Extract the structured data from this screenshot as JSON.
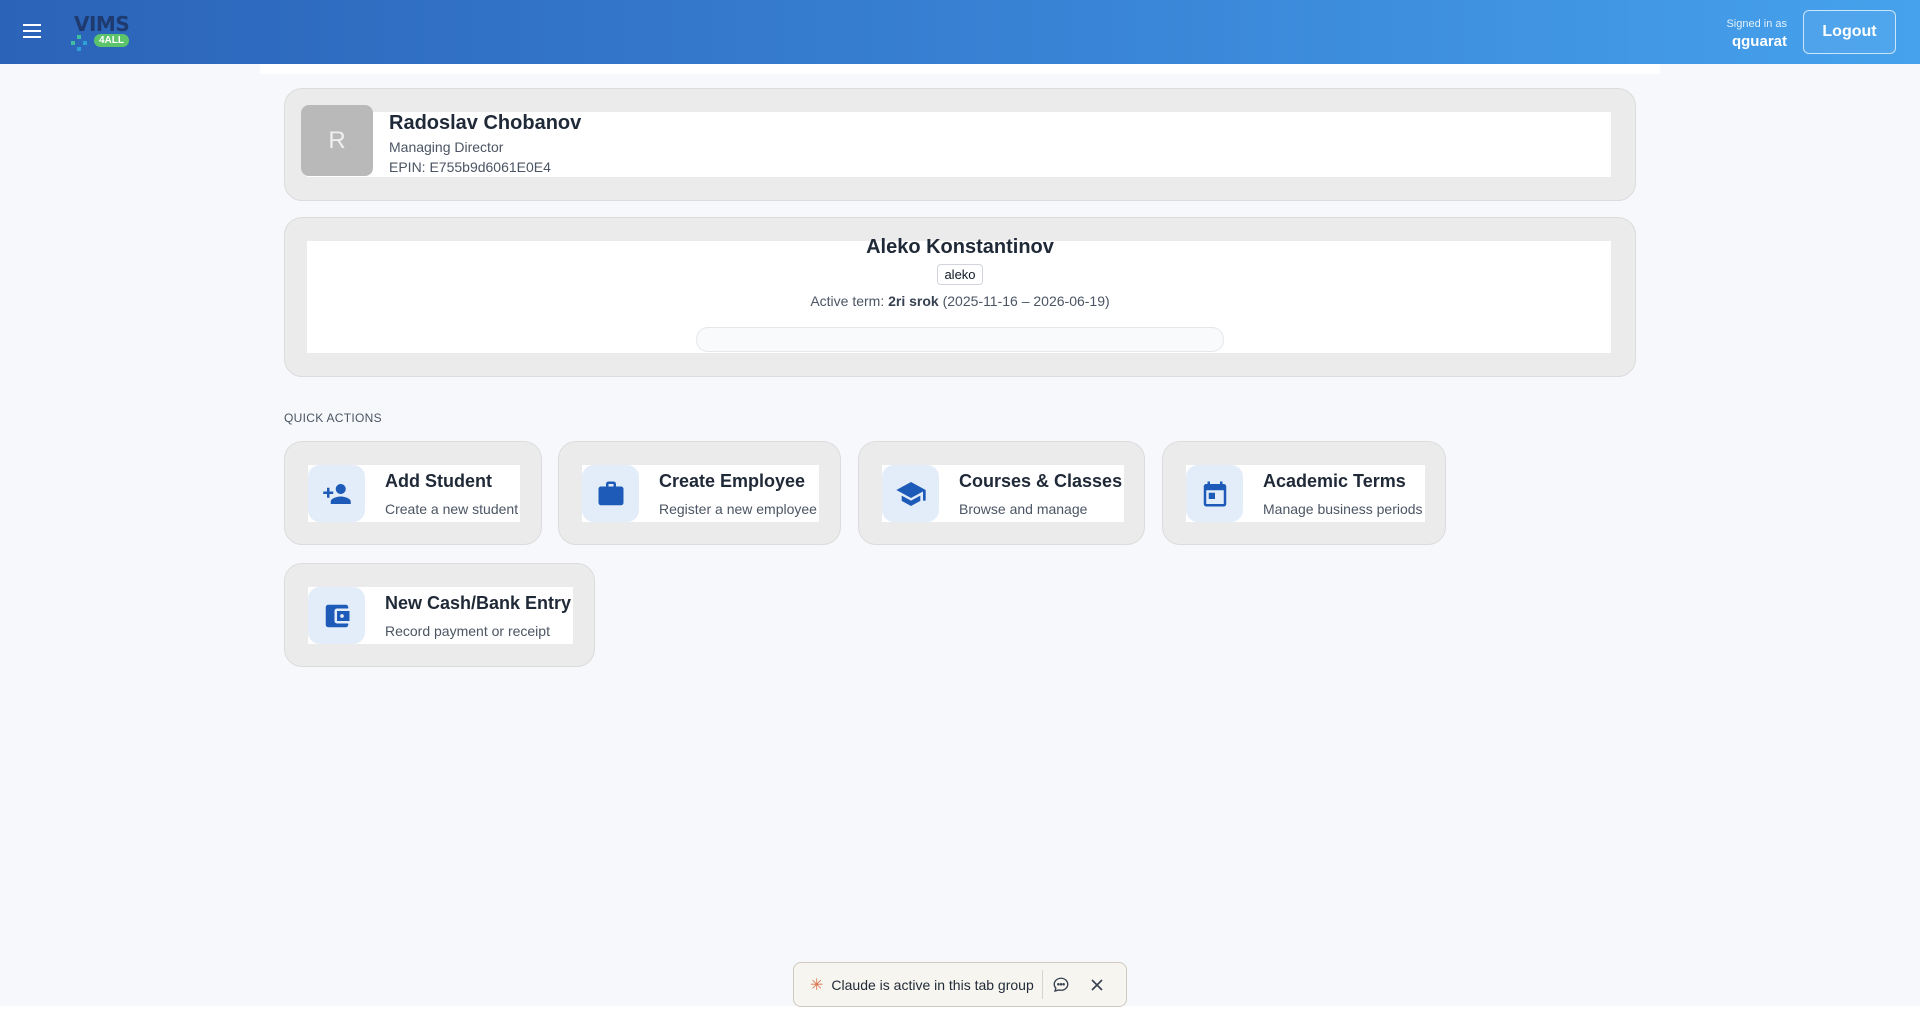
{
  "header": {
    "logo_text": "VIMS",
    "logo_badge": "4ALL",
    "signed_in_label": "Signed in as",
    "username": "qguarat",
    "logout_label": "Logout"
  },
  "profile": {
    "initial": "R",
    "name": "Radoslav Chobanov",
    "role": "Managing Director",
    "epin": "EPIN: E755b9d6061E0E4"
  },
  "student": {
    "name": "Aleko Konstantinov",
    "tag": "aleko",
    "term_prefix": "Active term:",
    "term_name": "2ri srok",
    "term_dates": "(2025-11-16 – 2026-06-19)",
    "term_progress": 0
  },
  "quick_actions": {
    "title": "QUICK ACTIONS",
    "items": [
      {
        "title": "Add Student",
        "subtitle": "Create a new student",
        "icon": "person-add-icon"
      },
      {
        "title": "Create Employee",
        "subtitle": "Register a new employee",
        "icon": "briefcase-icon"
      },
      {
        "title": "Courses & Classes",
        "subtitle": "Browse and manage",
        "icon": "graduation-cap-icon"
      },
      {
        "title": "Academic Terms",
        "subtitle": "Manage business periods",
        "icon": "calendar-icon"
      },
      {
        "title": "New Cash/Bank Entry",
        "subtitle": "Record payment or receipt",
        "icon": "wallet-icon"
      }
    ]
  },
  "claude_bar": {
    "label": "Claude is active in this tab group"
  },
  "colors": {
    "header_start": "#2b63b8",
    "header_end": "#46a2ec",
    "icon_accent": "#1e5bb8",
    "icon_bg": "#e3ecf9"
  }
}
